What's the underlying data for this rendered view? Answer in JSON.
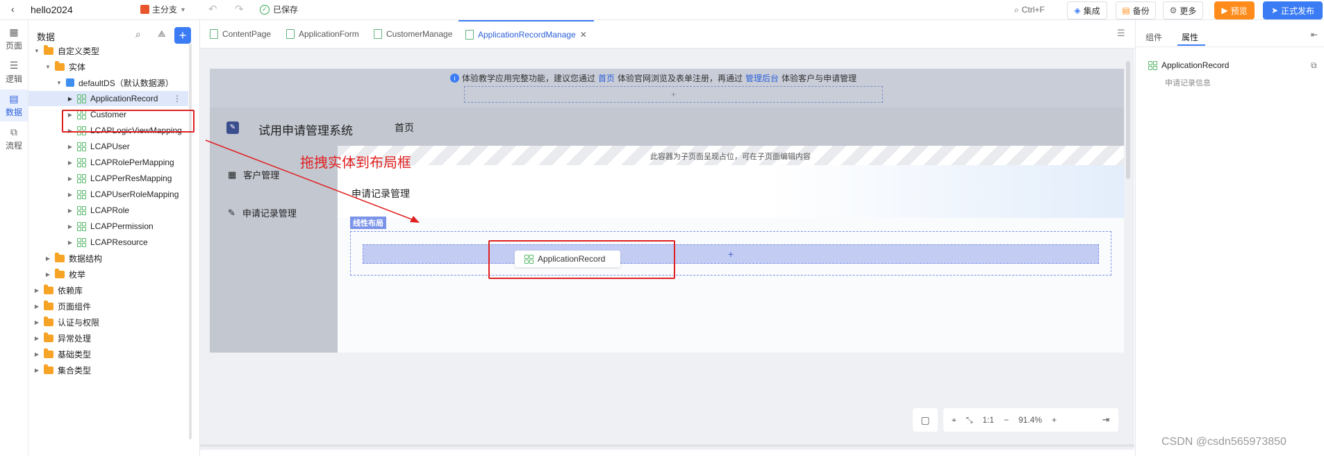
{
  "topbar": {
    "project_name": "hello2024",
    "branch": "主分支",
    "save_status": "已保存",
    "search_shortcut": "Ctrl+F",
    "integrate": "集成",
    "backup": "备份",
    "more": "更多",
    "preview": "预览",
    "publish": "正式发布"
  },
  "rail": [
    "页面",
    "逻辑",
    "数据",
    "流程"
  ],
  "tree": {
    "title": "数据",
    "items": [
      {
        "label": "自定义类型",
        "level": 0,
        "type": "folder",
        "open": true
      },
      {
        "label": "实体",
        "level": 1,
        "type": "folder",
        "open": true
      },
      {
        "label": "defaultDS（默认数据源）",
        "level": 2,
        "type": "db",
        "open": true
      },
      {
        "label": "ApplicationRecord",
        "level": 3,
        "type": "entity",
        "selected": true
      },
      {
        "label": "Customer",
        "level": 3,
        "type": "entity"
      },
      {
        "label": "LCAPLogicViewMapping",
        "level": 3,
        "type": "entity"
      },
      {
        "label": "LCAPUser",
        "level": 3,
        "type": "entity"
      },
      {
        "label": "LCAPRolePerMapping",
        "level": 3,
        "type": "entity"
      },
      {
        "label": "LCAPPerResMapping",
        "level": 3,
        "type": "entity"
      },
      {
        "label": "LCAPUserRoleMapping",
        "level": 3,
        "type": "entity"
      },
      {
        "label": "LCAPRole",
        "level": 3,
        "type": "entity"
      },
      {
        "label": "LCAPPermission",
        "level": 3,
        "type": "entity"
      },
      {
        "label": "LCAPResource",
        "level": 3,
        "type": "entity"
      },
      {
        "label": "数据结构",
        "level": 1,
        "type": "folder"
      },
      {
        "label": "枚举",
        "level": 1,
        "type": "folder"
      },
      {
        "label": "依赖库",
        "level": 0,
        "type": "folder"
      },
      {
        "label": "页面组件",
        "level": 0,
        "type": "folder"
      },
      {
        "label": "认证与权限",
        "level": 0,
        "type": "folder"
      },
      {
        "label": "异常处理",
        "level": 0,
        "type": "folder"
      },
      {
        "label": "基础类型",
        "level": 0,
        "type": "folder"
      },
      {
        "label": "集合类型",
        "level": 0,
        "type": "folder"
      }
    ]
  },
  "tabs": [
    {
      "label": "ContentPage"
    },
    {
      "label": "ApplicationForm"
    },
    {
      "label": "CustomerManage"
    },
    {
      "label": "ApplicationRecordManage",
      "active": true
    }
  ],
  "canvas": {
    "notice_prefix": "体验教学应用完整功能，建议您通过",
    "notice_link1": "首页",
    "notice_mid": "体验官网浏览及表单注册，再通过",
    "notice_link2": "管理后台",
    "notice_suffix": "体验客户与申请管理",
    "app_title": "试用申请管理系统",
    "nav_home": "首页",
    "subpage_hint": "此容器为子页面呈现占位，可在子页面编辑内容",
    "menu": [
      "客户管理",
      "申请记录管理"
    ],
    "section_title": "申请记录管理",
    "layout_tag": "线性布局",
    "drag_item": "ApplicationRecord",
    "annotation": "拖拽实体到布局框",
    "plus": "+",
    "zoom_ratio": "1:1",
    "zoom_level": "91.4%"
  },
  "rpanel": {
    "tab_components": "组件",
    "tab_properties": "属性",
    "entity_name": "ApplicationRecord",
    "entity_desc": "申请记录信息"
  },
  "watermark": "CSDN @csdn565973850",
  "colors": {
    "accent": "#3b7cf5",
    "annotation": "#e02020",
    "orange": "#ff8c1a"
  }
}
